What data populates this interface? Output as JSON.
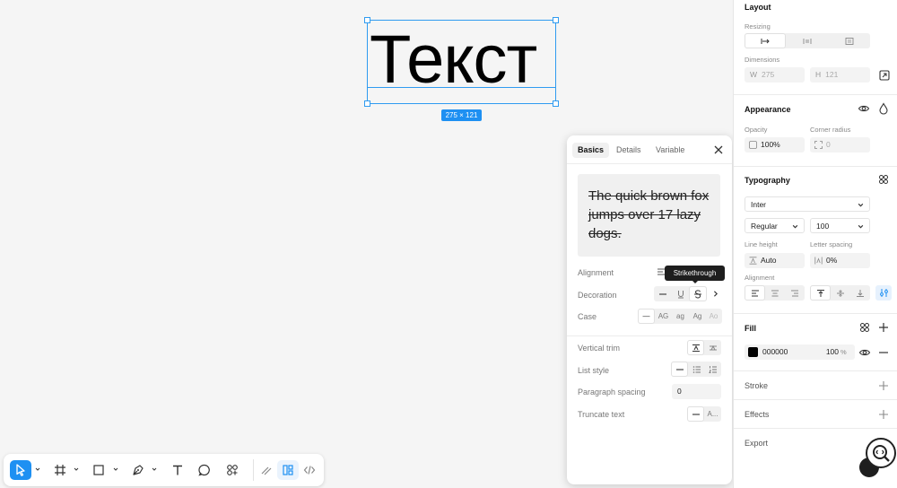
{
  "canvas": {
    "text_content": "Текст",
    "size_badge": "275 × 121"
  },
  "popup": {
    "tabs": [
      "Basics",
      "Details",
      "Variable"
    ],
    "preview_text": "The quick brown fox jumps over 17 lazy dogs.",
    "alignment_label": "Alignment",
    "decoration_label": "Decoration",
    "case_label": "Case",
    "case_options": [
      "—",
      "AG",
      "ag",
      "Ag",
      "Ao"
    ],
    "vertical_trim_label": "Vertical trim",
    "list_style_label": "List style",
    "paragraph_spacing_label": "Paragraph spacing",
    "paragraph_spacing_value": "0",
    "truncate_label": "Truncate text",
    "truncate_option": "A...",
    "tooltip": "Strikethrough"
  },
  "panel": {
    "layout": {
      "title": "Layout",
      "resizing_label": "Resizing",
      "dimensions_label": "Dimensions",
      "w_prefix": "W",
      "w_value": "275",
      "h_prefix": "H",
      "h_value": "121"
    },
    "appearance": {
      "title": "Appearance",
      "opacity_label": "Opacity",
      "opacity_value": "100%",
      "radius_label": "Corner radius",
      "radius_value": "0"
    },
    "typography": {
      "title": "Typography",
      "font": "Inter",
      "weight": "Regular",
      "size": "100",
      "line_height_label": "Line height",
      "line_height_value": "Auto",
      "letter_spacing_label": "Letter spacing",
      "letter_spacing_value": "0%",
      "alignment_label": "Alignment"
    },
    "fill": {
      "title": "Fill",
      "hex": "000000",
      "opacity": "100",
      "unit": "%",
      "swatch_color": "#000000"
    },
    "stroke_title": "Stroke",
    "effects_title": "Effects",
    "export_title": "Export"
  },
  "colors": {
    "accent": "#1e90f2",
    "selection": "#2f9bf0"
  }
}
